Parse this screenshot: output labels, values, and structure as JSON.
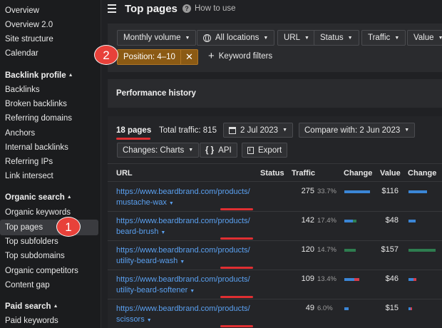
{
  "sidebar": {
    "items_top": [
      "Overview",
      "Overview 2.0",
      "Site structure",
      "Calendar"
    ],
    "backlink_profile": {
      "heading": "Backlink profile",
      "items": [
        "Backlinks",
        "Broken backlinks",
        "Referring domains",
        "Anchors",
        "Internal backlinks",
        "Referring IPs",
        "Link intersect"
      ]
    },
    "organic_search": {
      "heading": "Organic search",
      "items": [
        "Organic keywords",
        "Top pages",
        "Top subfolders",
        "Top subdomains",
        "Organic competitors",
        "Content gap"
      ]
    },
    "paid_search": {
      "heading": "Paid search",
      "items": [
        "Paid keywords"
      ]
    },
    "active_item": "Top pages"
  },
  "header": {
    "title": "Top pages",
    "help_label": "How to use"
  },
  "filters": {
    "buttons": [
      "Monthly volume",
      "All locations",
      "URL",
      "Status",
      "Traffic",
      "Value"
    ],
    "active_chip": "Position: 4–10",
    "keyword_filters_label": "Keyword filters"
  },
  "performance": {
    "title": "Performance history"
  },
  "summary": {
    "pages_count": "18 pages",
    "total_traffic": "Total traffic: 815",
    "date": "2 Jul 2023",
    "compare": "Compare with: 2 Jun 2023",
    "changes": "Changes: Charts",
    "api": "API",
    "export": "Export"
  },
  "table": {
    "columns": [
      "URL",
      "Status",
      "Traffic",
      "Change",
      "Value",
      "Change"
    ],
    "rows": [
      {
        "url_line1": "https://www.beardbrand.com/products/",
        "url_line2": "mustache-wax",
        "traffic": "275",
        "traffic_pct": "33.7%",
        "value": "$116"
      },
      {
        "url_line1": "https://www.beardbrand.com/products/",
        "url_line2": "beard-brush",
        "traffic": "142",
        "traffic_pct": "17.4%",
        "value": "$48"
      },
      {
        "url_line1": "https://www.beardbrand.com/products/",
        "url_line2": "utility-beard-wash",
        "traffic": "120",
        "traffic_pct": "14.7%",
        "value": "$157"
      },
      {
        "url_line1": "https://www.beardbrand.com/products/",
        "url_line2": "utility-beard-softener",
        "traffic": "109",
        "traffic_pct": "13.4%",
        "value": "$46"
      },
      {
        "url_line1": "https://www.beardbrand.com/products/",
        "url_line2": "scissors",
        "traffic": "49",
        "traffic_pct": "6.0%",
        "value": "$15"
      }
    ]
  },
  "annotations": {
    "badge_1": "1",
    "badge_2": "2"
  },
  "colors": {
    "link": "#5aa0f0",
    "chip": "#8b5a14",
    "badge": "#e8413a",
    "bar_blue": "#3b86d6",
    "bar_green": "#2e7d4f",
    "bar_red": "#d63b4a"
  }
}
